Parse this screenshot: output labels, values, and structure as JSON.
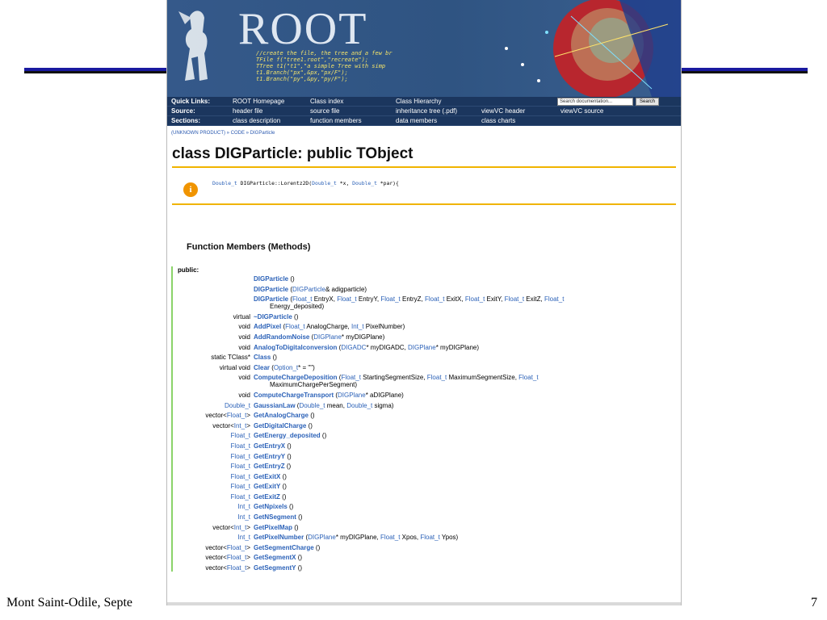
{
  "footer": {
    "left": "Mont Saint-Odile, Septe",
    "right": "7"
  },
  "banner": {
    "logo": "ROOT",
    "code_lines": [
      "//create the file, the tree and a few br",
      "TFile f(\"tree1.root\",\"recreate\");",
      "TTree t1(\"t1\",\"a simple Tree with simp",
      "t1.Branch(\"px\",&px,\"px/F\");",
      "t1.Branch(\"py\",&py,\"py/F\");"
    ]
  },
  "nav": {
    "rows": [
      {
        "label": "Quick Links:",
        "cells": [
          "ROOT Homepage",
          "Class index",
          "Class Hierarchy"
        ]
      },
      {
        "label": "Source:",
        "cells": [
          "header file",
          "source file",
          "inheritance tree (.pdf)",
          "viewVC header",
          "viewVC source"
        ]
      },
      {
        "label": "Sections:",
        "cells": [
          "class description",
          "function members",
          "data members",
          "class charts"
        ]
      }
    ],
    "search_placeholder": "Search documentation...",
    "search_button": "Search"
  },
  "breadcrumb": "(UNKNOWN PRODUCT) » CODE » DIGParticle",
  "class_title": "class DIGParticle: public TObject",
  "info": {
    "t1": "Double_t",
    "name": " DIGParticle::Lorentz2D(",
    "t2": "Double_t",
    "mid": " *x, ",
    "t3": "Double_t",
    "end": " *par){"
  },
  "section_title": "Function Members (Methods)",
  "public_label": "public:",
  "members": [
    {
      "ret": [],
      "parts": [
        [
          "n",
          "DIGParticle"
        ],
        [
          "p",
          " ()"
        ]
      ]
    },
    {
      "ret": [],
      "parts": [
        [
          "n",
          "DIGParticle"
        ],
        [
          "p",
          " ("
        ],
        [
          "t",
          "DIGParticle"
        ],
        [
          "p",
          "& adigparticle)"
        ]
      ]
    },
    {
      "ret": [],
      "parts": [
        [
          "n",
          "DIGParticle"
        ],
        [
          "p",
          " ("
        ],
        [
          "t",
          "Float_t"
        ],
        [
          "p",
          " EntryX, "
        ],
        [
          "t",
          "Float_t"
        ],
        [
          "p",
          " EntryY, "
        ],
        [
          "t",
          "Float_t"
        ],
        [
          "p",
          " EntryZ, "
        ],
        [
          "t",
          "Float_t"
        ],
        [
          "p",
          " ExitX, "
        ],
        [
          "t",
          "Float_t"
        ],
        [
          "p",
          " ExitY, "
        ],
        [
          "t",
          "Float_t"
        ],
        [
          "p",
          " ExitZ, "
        ],
        [
          "t",
          "Float_t"
        ]
      ],
      "wrap": "Energy_deposited)"
    },
    {
      "ret": [
        [
          "p",
          "virtual"
        ]
      ],
      "parts": [
        [
          "n",
          "~DIGParticle"
        ],
        [
          "p",
          " ()"
        ]
      ]
    },
    {
      "ret": [
        [
          "p",
          "void"
        ]
      ],
      "parts": [
        [
          "n",
          "AddPixel"
        ],
        [
          "p",
          " ("
        ],
        [
          "t",
          "Float_t"
        ],
        [
          "p",
          " AnalogCharge, "
        ],
        [
          "t",
          "Int_t"
        ],
        [
          "p",
          " PixelNumber)"
        ]
      ]
    },
    {
      "ret": [
        [
          "p",
          "void"
        ]
      ],
      "parts": [
        [
          "n",
          "AddRandomNoise"
        ],
        [
          "p",
          " ("
        ],
        [
          "t",
          "DIGPlane"
        ],
        [
          "p",
          "* myDIGPlane)"
        ]
      ]
    },
    {
      "ret": [
        [
          "p",
          "void"
        ]
      ],
      "parts": [
        [
          "n",
          "AnalogToDigitalconversion"
        ],
        [
          "p",
          " ("
        ],
        [
          "t",
          "DIGADC"
        ],
        [
          "p",
          "* myDIGADC, "
        ],
        [
          "t",
          "DIGPlane"
        ],
        [
          "p",
          "* myDIGPlane)"
        ]
      ]
    },
    {
      "ret": [
        [
          "p",
          "static TClass*"
        ]
      ],
      "parts": [
        [
          "n",
          "Class"
        ],
        [
          "p",
          " ()"
        ]
      ]
    },
    {
      "ret": [
        [
          "p",
          "virtual void"
        ]
      ],
      "parts": [
        [
          "n",
          "Clear"
        ],
        [
          "p",
          " ("
        ],
        [
          "t",
          "Option_t"
        ],
        [
          "p",
          "* = \"\")"
        ]
      ]
    },
    {
      "ret": [
        [
          "p",
          "void"
        ]
      ],
      "parts": [
        [
          "n",
          "ComputeChargeDeposition"
        ],
        [
          "p",
          " ("
        ],
        [
          "t",
          "Float_t"
        ],
        [
          "p",
          " StartingSegmentSize, "
        ],
        [
          "t",
          "Float_t"
        ],
        [
          "p",
          " MaximumSegmentSize, "
        ],
        [
          "t",
          "Float_t"
        ]
      ],
      "wrap": "MaximumChargePerSegment)"
    },
    {
      "ret": [
        [
          "p",
          "void"
        ]
      ],
      "parts": [
        [
          "n",
          "ComputeChargeTransport"
        ],
        [
          "p",
          " ("
        ],
        [
          "t",
          "DIGPlane"
        ],
        [
          "p",
          "* aDIGPlane)"
        ]
      ]
    },
    {
      "ret": [
        [
          "t",
          "Double_t"
        ]
      ],
      "parts": [
        [
          "n",
          "GaussianLaw"
        ],
        [
          "p",
          " ("
        ],
        [
          "t",
          "Double_t"
        ],
        [
          "p",
          " mean, "
        ],
        [
          "t",
          "Double_t"
        ],
        [
          "p",
          " sigma)"
        ]
      ]
    },
    {
      "ret": [
        [
          "p",
          "vector<"
        ],
        [
          "t",
          "Float_t"
        ],
        [
          "p",
          ">"
        ]
      ],
      "parts": [
        [
          "n",
          "GetAnalogCharge"
        ],
        [
          "p",
          " ()"
        ]
      ]
    },
    {
      "ret": [
        [
          "p",
          "vector<"
        ],
        [
          "t",
          "Int_t"
        ],
        [
          "p",
          ">"
        ]
      ],
      "parts": [
        [
          "n",
          "GetDigitalCharge"
        ],
        [
          "p",
          " ()"
        ]
      ]
    },
    {
      "ret": [
        [
          "t",
          "Float_t"
        ]
      ],
      "parts": [
        [
          "n",
          "GetEnergy_deposited"
        ],
        [
          "p",
          " ()"
        ]
      ]
    },
    {
      "ret": [
        [
          "t",
          "Float_t"
        ]
      ],
      "parts": [
        [
          "n",
          "GetEntryX"
        ],
        [
          "p",
          " ()"
        ]
      ]
    },
    {
      "ret": [
        [
          "t",
          "Float_t"
        ]
      ],
      "parts": [
        [
          "n",
          "GetEntryY"
        ],
        [
          "p",
          " ()"
        ]
      ]
    },
    {
      "ret": [
        [
          "t",
          "Float_t"
        ]
      ],
      "parts": [
        [
          "n",
          "GetEntryZ"
        ],
        [
          "p",
          " ()"
        ]
      ]
    },
    {
      "ret": [
        [
          "t",
          "Float_t"
        ]
      ],
      "parts": [
        [
          "n",
          "GetExitX"
        ],
        [
          "p",
          " ()"
        ]
      ]
    },
    {
      "ret": [
        [
          "t",
          "Float_t"
        ]
      ],
      "parts": [
        [
          "n",
          "GetExitY"
        ],
        [
          "p",
          " ()"
        ]
      ]
    },
    {
      "ret": [
        [
          "t",
          "Float_t"
        ]
      ],
      "parts": [
        [
          "n",
          "GetExitZ"
        ],
        [
          "p",
          " ()"
        ]
      ]
    },
    {
      "ret": [
        [
          "t",
          "Int_t"
        ]
      ],
      "parts": [
        [
          "n",
          "GetNpixels"
        ],
        [
          "p",
          " ()"
        ]
      ]
    },
    {
      "ret": [
        [
          "t",
          "Int_t"
        ]
      ],
      "parts": [
        [
          "n",
          "GetNSegment"
        ],
        [
          "p",
          " ()"
        ]
      ]
    },
    {
      "ret": [
        [
          "p",
          "vector<"
        ],
        [
          "t",
          "Int_t"
        ],
        [
          "p",
          ">"
        ]
      ],
      "parts": [
        [
          "n",
          "GetPixelMap"
        ],
        [
          "p",
          " ()"
        ]
      ]
    },
    {
      "ret": [
        [
          "t",
          "Int_t"
        ]
      ],
      "parts": [
        [
          "n",
          "GetPixelNumber"
        ],
        [
          "p",
          " ("
        ],
        [
          "t",
          "DIGPlane"
        ],
        [
          "p",
          "* myDIGPlane, "
        ],
        [
          "t",
          "Float_t"
        ],
        [
          "p",
          " Xpos, "
        ],
        [
          "t",
          "Float_t"
        ],
        [
          "p",
          " Ypos)"
        ]
      ]
    },
    {
      "ret": [
        [
          "p",
          "vector<"
        ],
        [
          "t",
          "Float_t"
        ],
        [
          "p",
          ">"
        ]
      ],
      "parts": [
        [
          "n",
          "GetSegmentCharge"
        ],
        [
          "p",
          " ()"
        ]
      ]
    },
    {
      "ret": [
        [
          "p",
          "vector<"
        ],
        [
          "t",
          "Float_t"
        ],
        [
          "p",
          ">"
        ]
      ],
      "parts": [
        [
          "n",
          "GetSegmentX"
        ],
        [
          "p",
          " ()"
        ]
      ]
    },
    {
      "ret": [
        [
          "p",
          "vector<"
        ],
        [
          "t",
          "Float_t"
        ],
        [
          "p",
          ">"
        ]
      ],
      "parts": [
        [
          "n",
          "GetSegmentY"
        ],
        [
          "p",
          " ()"
        ]
      ]
    }
  ]
}
